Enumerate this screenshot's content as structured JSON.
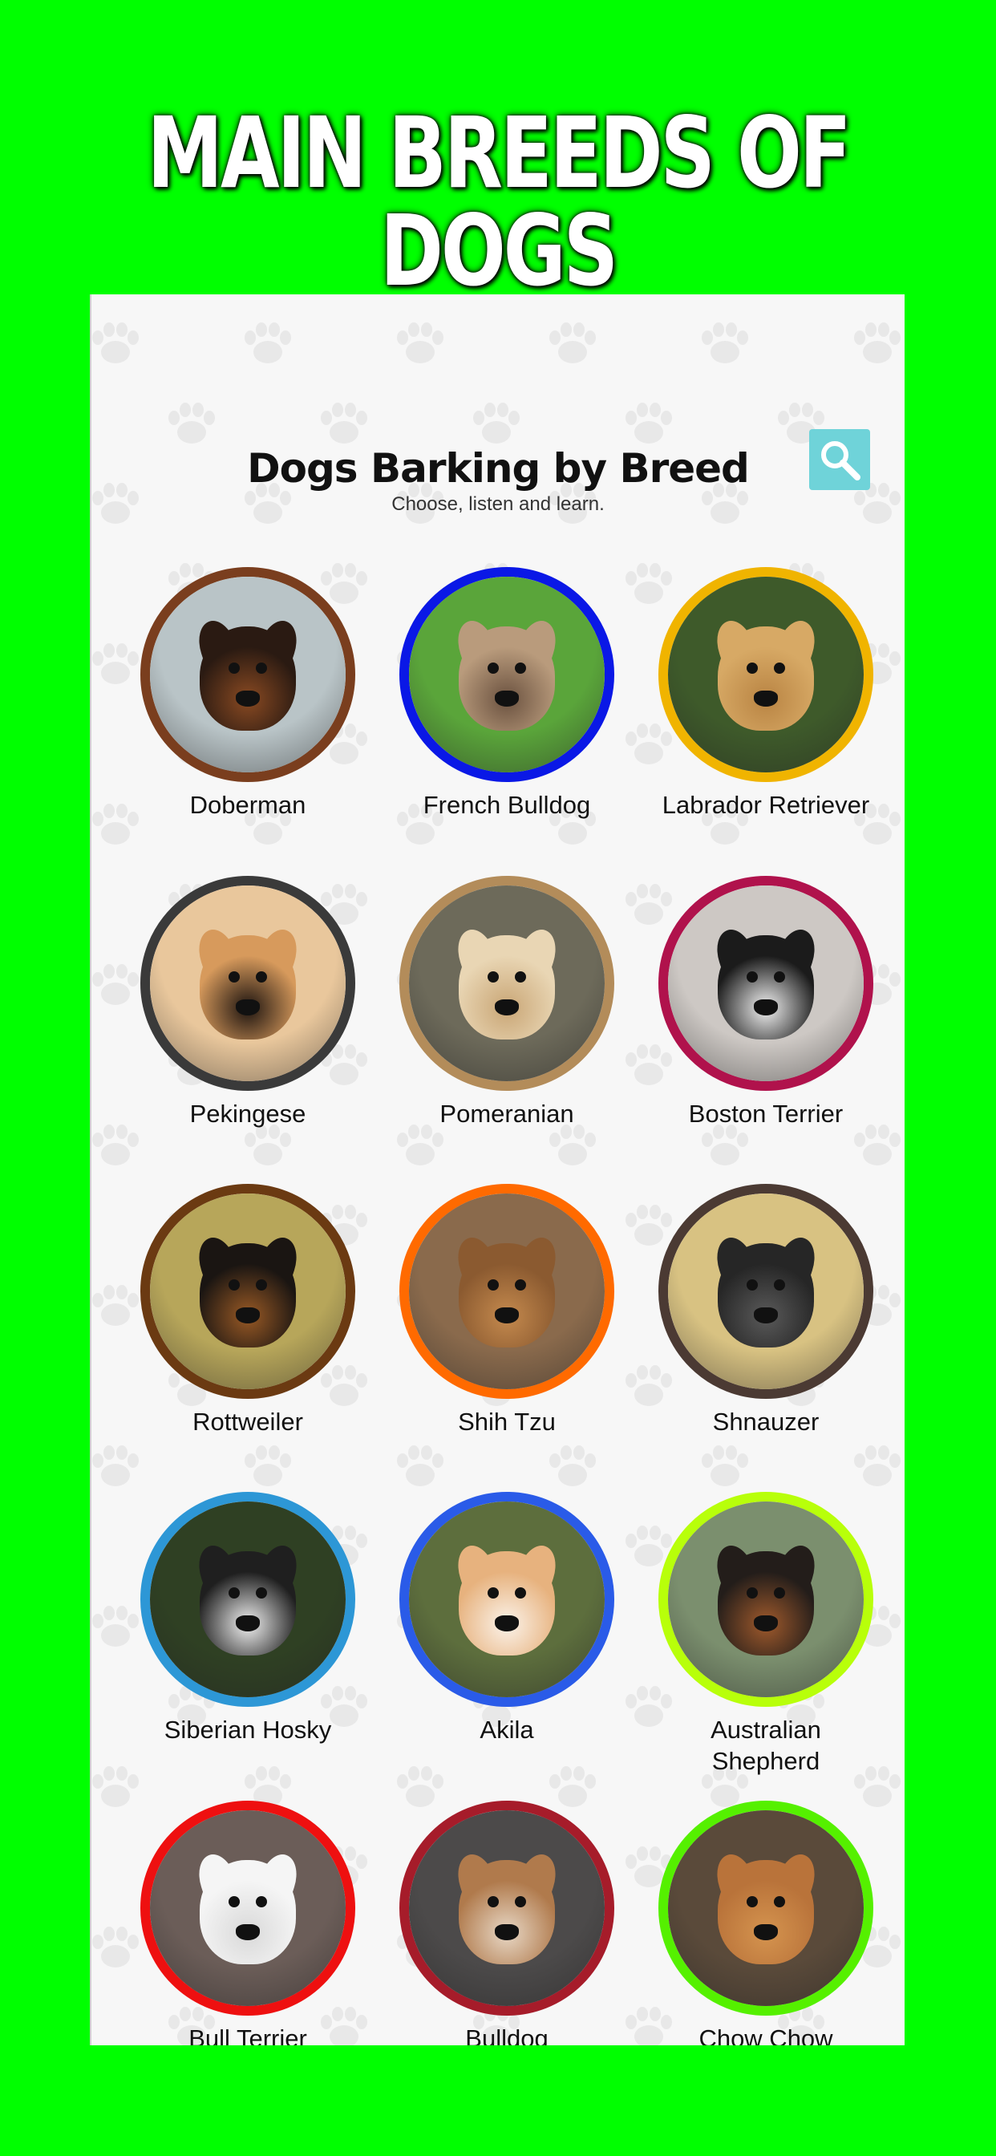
{
  "promo": {
    "title": "MAIN BREEDS OF DOGS"
  },
  "app": {
    "title": "Dogs Barking by Breed",
    "subtitle": "Choose, listen and learn."
  },
  "breeds": [
    {
      "name": "Doberman",
      "ring": "#7a3e1e",
      "bg": "#b9c4c7",
      "fur": "#2a1a12",
      "accent": "#8a4a22"
    },
    {
      "name": "French Bulldog",
      "ring": "#0a18e6",
      "bg": "#5aa53a",
      "fur": "#b99b7c",
      "accent": "#6b5240"
    },
    {
      "name": "Labrador Retriever",
      "ring": "#f0b400",
      "bg": "#3e5a2a",
      "fur": "#d7a965",
      "accent": "#b98443"
    },
    {
      "name": "Pekingese",
      "ring": "#3a3a3a",
      "bg": "#e9c79c",
      "fur": "#d79a5c",
      "accent": "#1d1410"
    },
    {
      "name": "Pomeranian",
      "ring": "#b38c5a",
      "bg": "#6d6a5a",
      "fur": "#e9d6b4",
      "accent": "#c9a676"
    },
    {
      "name": "Boston Terrier",
      "ring": "#b0124c",
      "bg": "#cdc8c4",
      "fur": "#1b1b1b",
      "accent": "#f2f2f2"
    },
    {
      "name": "Rottweiler",
      "ring": "#6b3a12",
      "bg": "#b7a65a",
      "fur": "#1a1512",
      "accent": "#9a5a25"
    },
    {
      "name": "Shih Tzu",
      "ring": "#ff6a00",
      "bg": "#8a6a4c",
      "fur": "#8b5a30",
      "accent": "#c58a4e"
    },
    {
      "name": "Shnauzer",
      "ring": "#4b3a33",
      "bg": "#d8c282",
      "fur": "#262626",
      "accent": "#5a5a5a"
    },
    {
      "name": "Siberian Hosky",
      "ring": "#2d97d6",
      "bg": "#2f4023",
      "fur": "#1f1f1f",
      "accent": "#f1f1f1"
    },
    {
      "name": "Akila",
      "ring": "#2a5be8",
      "bg": "#5d6e3d",
      "fur": "#e7b27e",
      "accent": "#fbf3ea"
    },
    {
      "name": "Australian Shepherd",
      "ring": "#b8ff0a",
      "bg": "#7b8f6e",
      "fur": "#231d1a",
      "accent": "#a05a2c"
    },
    {
      "name": "Bull Terrier",
      "ring": "#ee1010",
      "bg": "#6b5d58",
      "fur": "#f5f5f5",
      "accent": "#d9d9d9"
    },
    {
      "name": "Bulldog",
      "ring": "#a61c2a",
      "bg": "#4c4a4a",
      "fur": "#b07a4c",
      "accent": "#e8d8c6"
    },
    {
      "name": "Chow Chow",
      "ring": "#55f000",
      "bg": "#5a4a3a",
      "fur": "#b9733a",
      "accent": "#d5944f"
    }
  ],
  "icons": {
    "search": "magnifier-icon",
    "paw": "paw-icon"
  }
}
